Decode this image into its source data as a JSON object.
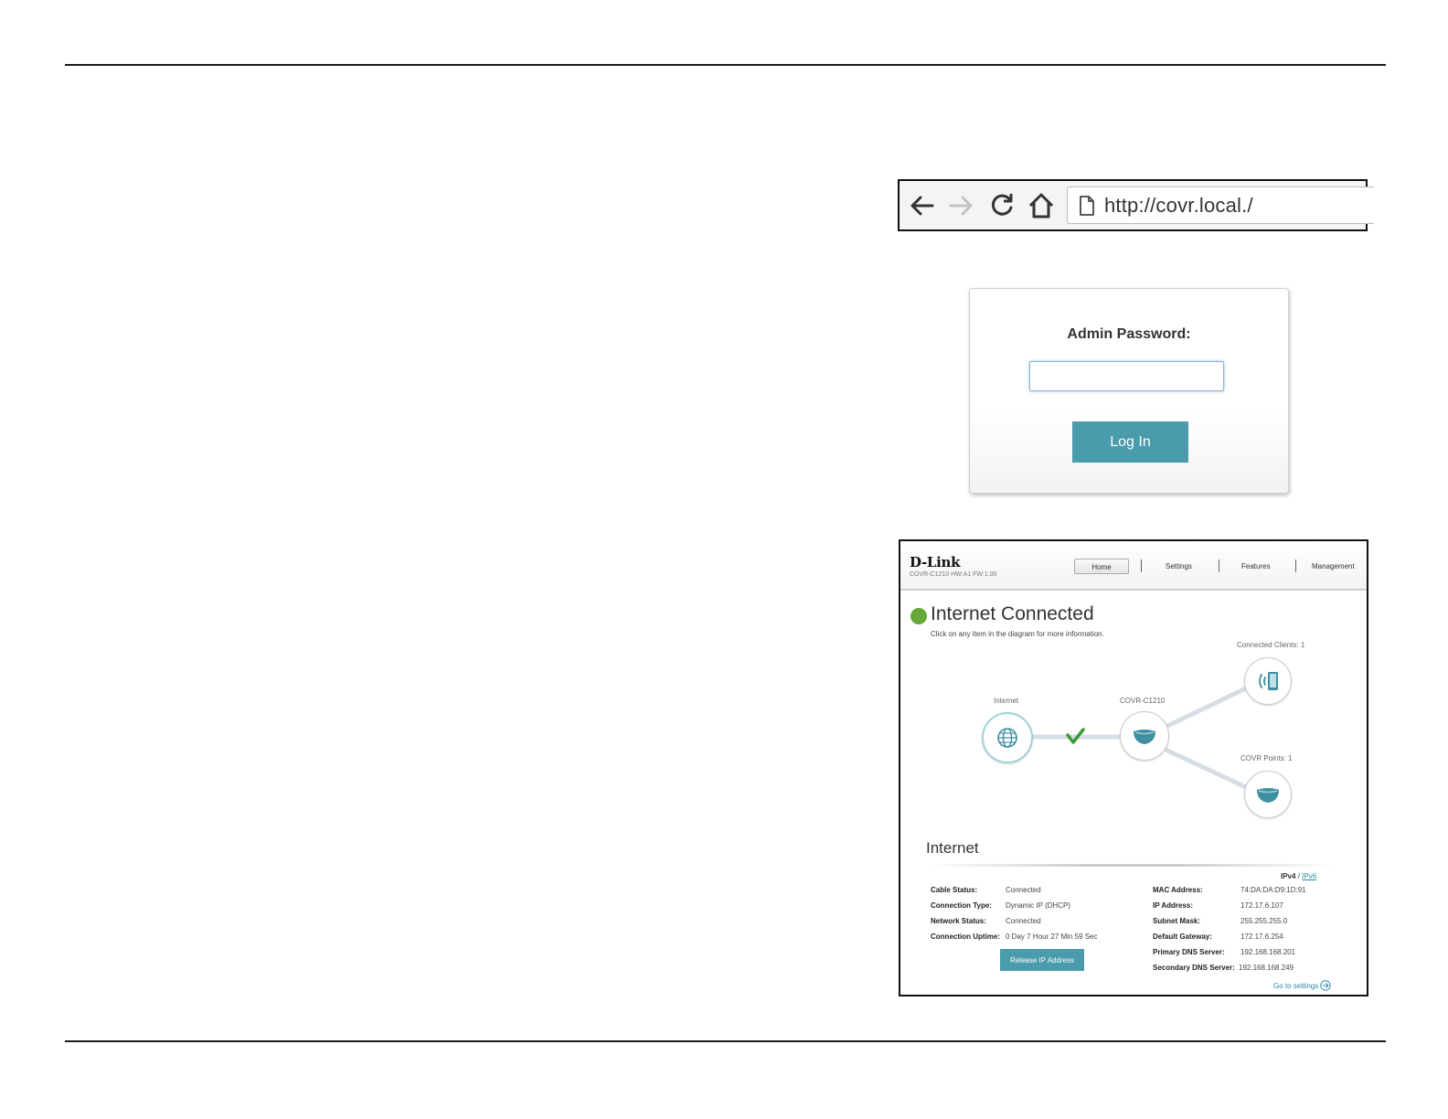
{
  "browser": {
    "url": "http://covr.local./"
  },
  "login": {
    "label": "Admin Password:",
    "password_value": "",
    "login_button": "Log In"
  },
  "dashboard": {
    "logo": "D-Link",
    "model_info": "COVR-C1210 HW:A1 FW:1.00",
    "nav": [
      "Home",
      "Settings",
      "Features",
      "Management"
    ],
    "status_title": "Internet Connected",
    "status_hint": "Click on any item in the diagram for more information.",
    "diagram": {
      "internet_label": "Internet",
      "router_label": "COVR-C1210",
      "clients_label": "Connected Clients: 1",
      "points_label": "COVR Points: 1"
    },
    "section_title": "Internet",
    "ip_toggle": {
      "ipv4": "IPv4",
      "sep": "/",
      "ipv6": "IPv6"
    },
    "left_info": [
      {
        "key": "Cable Status:",
        "value": "Connected"
      },
      {
        "key": "Connection Type:",
        "value": "Dynamic IP (DHCP)"
      },
      {
        "key": "Network Status:",
        "value": "Connected"
      },
      {
        "key": "Connection Uptime:",
        "value": "0 Day 7 Hour 27 Min 59 Sec"
      }
    ],
    "right_info": [
      {
        "key": "MAC Address:",
        "value": "74:DA:DA:D9:1D:91"
      },
      {
        "key": "IP Address:",
        "value": "172.17.6.107"
      },
      {
        "key": "Subnet Mask:",
        "value": "255.255.255.0"
      },
      {
        "key": "Default Gateway:",
        "value": "172.17.6.254"
      },
      {
        "key": "Primary DNS Server:",
        "value": "192.168.168.201"
      },
      {
        "key": "Secondary DNS Server:",
        "value": "192.168.168.249"
      }
    ],
    "release_button": "Release IP Address",
    "settings_link": "Go to settings",
    "colors": {
      "accent": "#4a9bab",
      "status_green": "#66a83a",
      "check_green": "#3a9a3a"
    }
  }
}
